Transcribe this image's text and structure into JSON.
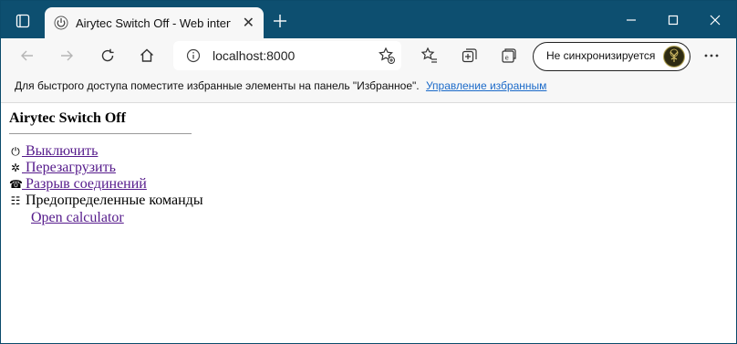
{
  "browser": {
    "tab": {
      "title": "Airytec Switch Off - Web interface"
    },
    "address": {
      "url": "localhost:8000"
    },
    "sync": {
      "label": "Не синхронизируется"
    },
    "favorites": {
      "message": "Для быстрого доступа поместите избранные элементы на панель \"Избранное\".",
      "manage_link": "Управление избранным"
    }
  },
  "page": {
    "title": "Airytec Switch Off",
    "actions": [
      {
        "label": " Выключить",
        "icon": "power-icon"
      },
      {
        "label": " Перезагрузить",
        "icon": "restart-icon"
      },
      {
        "label": " Разрыв соединений",
        "icon": "disconnect-icon"
      }
    ],
    "predefined": {
      "label": "Предопределенные команды",
      "icon": "commands-icon"
    },
    "commands": [
      {
        "label": "Open calculator"
      }
    ]
  }
}
